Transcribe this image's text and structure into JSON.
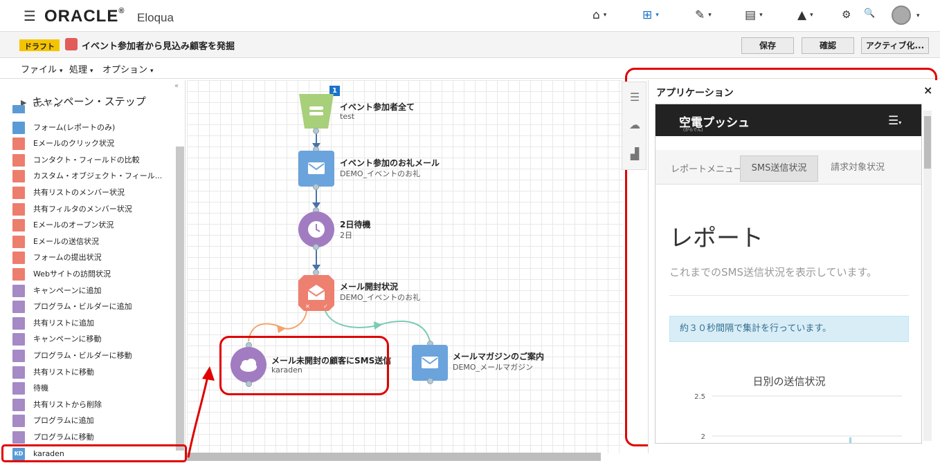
{
  "header": {
    "logo": "ORACLE",
    "logo_reg": "®",
    "product": "Eloqua",
    "menu_icon": "☰",
    "nav": [
      {
        "name": "home-icon",
        "glyph": "⌂"
      },
      {
        "name": "orchestration-icon",
        "glyph": "⊞"
      },
      {
        "name": "edit-icon",
        "glyph": "✎"
      },
      {
        "name": "contacts-icon",
        "glyph": "▤"
      },
      {
        "name": "insight-icon",
        "glyph": "▲"
      }
    ],
    "settings_icon": "⚙",
    "search_icon": "🔍",
    "caret": "▾"
  },
  "campaign": {
    "status": "ドラフト",
    "title": "イベント参加者から見込み顧客を発掘",
    "buttons": {
      "save": "保存",
      "confirm": "確認",
      "activate": "アクティブ化..."
    }
  },
  "menu": {
    "file": "ファイル",
    "process": "処理",
    "options": "オプション"
  },
  "steps_panel": {
    "collapse_glyph": "«",
    "heading": "キャンペーン・ステップ",
    "items": [
      {
        "label": "Eメール",
        "color": "#5b9bd5"
      },
      {
        "label": "フォーム(レポートのみ)",
        "color": "#5b9bd5"
      },
      {
        "label": "Eメールのクリック状況",
        "color": "#ed7d6d"
      },
      {
        "label": "コンタクト・フィールドの比較",
        "color": "#ed7d6d"
      },
      {
        "label": "カスタム・オブジェクト・フィール...",
        "color": "#ed7d6d"
      },
      {
        "label": "共有リストのメンバー状況",
        "color": "#ed7d6d"
      },
      {
        "label": "共有フィルタのメンバー状況",
        "color": "#ed7d6d"
      },
      {
        "label": "Eメールのオープン状況",
        "color": "#ed7d6d"
      },
      {
        "label": "Eメールの送信状況",
        "color": "#ed7d6d"
      },
      {
        "label": "フォームの提出状況",
        "color": "#ed7d6d"
      },
      {
        "label": "Webサイトの訪問状況",
        "color": "#ed7d6d"
      },
      {
        "label": "キャンペーンに追加",
        "color": "#a58ac5"
      },
      {
        "label": "プログラム・ビルダーに追加",
        "color": "#a58ac5"
      },
      {
        "label": "共有リストに追加",
        "color": "#a58ac5"
      },
      {
        "label": "キャンペーンに移動",
        "color": "#a58ac5"
      },
      {
        "label": "プログラム・ビルダーに移動",
        "color": "#a58ac5"
      },
      {
        "label": "共有リストに移動",
        "color": "#a58ac5"
      },
      {
        "label": "待機",
        "color": "#a58ac5"
      },
      {
        "label": "共有リストから削除",
        "color": "#a58ac5"
      },
      {
        "label": "プログラムに追加",
        "color": "#a58ac5"
      },
      {
        "label": "プログラムに移動",
        "color": "#a58ac5"
      },
      {
        "label": "karaden",
        "color": "#5b9bd5",
        "icon_text": "KD"
      }
    ]
  },
  "canvas": {
    "badge": "1",
    "nodes": [
      {
        "title": "イベント参加者全て",
        "sub": "test"
      },
      {
        "title": "イベント参加のお礼メール",
        "sub": "DEMO_イベントのお礼"
      },
      {
        "title": "2日待機",
        "sub": "2日"
      },
      {
        "title": "メール開封状況",
        "sub": "DEMO_イベントのお礼"
      },
      {
        "title": "メール未開封の顧客にSMS送信",
        "sub": "karaden"
      },
      {
        "title": "メールマガジンのご案内",
        "sub": "DEMO_メールマガジン"
      }
    ]
  },
  "app_panel": {
    "title": "アプリケーション",
    "close": "×",
    "brand": "空電プッシュ",
    "brand_small": "(からでん)",
    "tabs": [
      "レポートメニュー",
      "SMS送信状況",
      "請求対象状況"
    ],
    "active_tab": "SMS送信状況",
    "heading": "レポート",
    "lead": "これまでのSMS送信状況を表示しています。",
    "alert": "約３０秒間隔で集計を行っています。",
    "chart_title": "日別の送信状況"
  },
  "chart_data": {
    "type": "bar",
    "title": "日別の送信状況",
    "ytick_labels": [
      "2.5",
      "2"
    ],
    "series": []
  },
  "colors": {
    "highlight": "#e00000",
    "draft": "#f5c400",
    "accent": "#1a73c9"
  }
}
